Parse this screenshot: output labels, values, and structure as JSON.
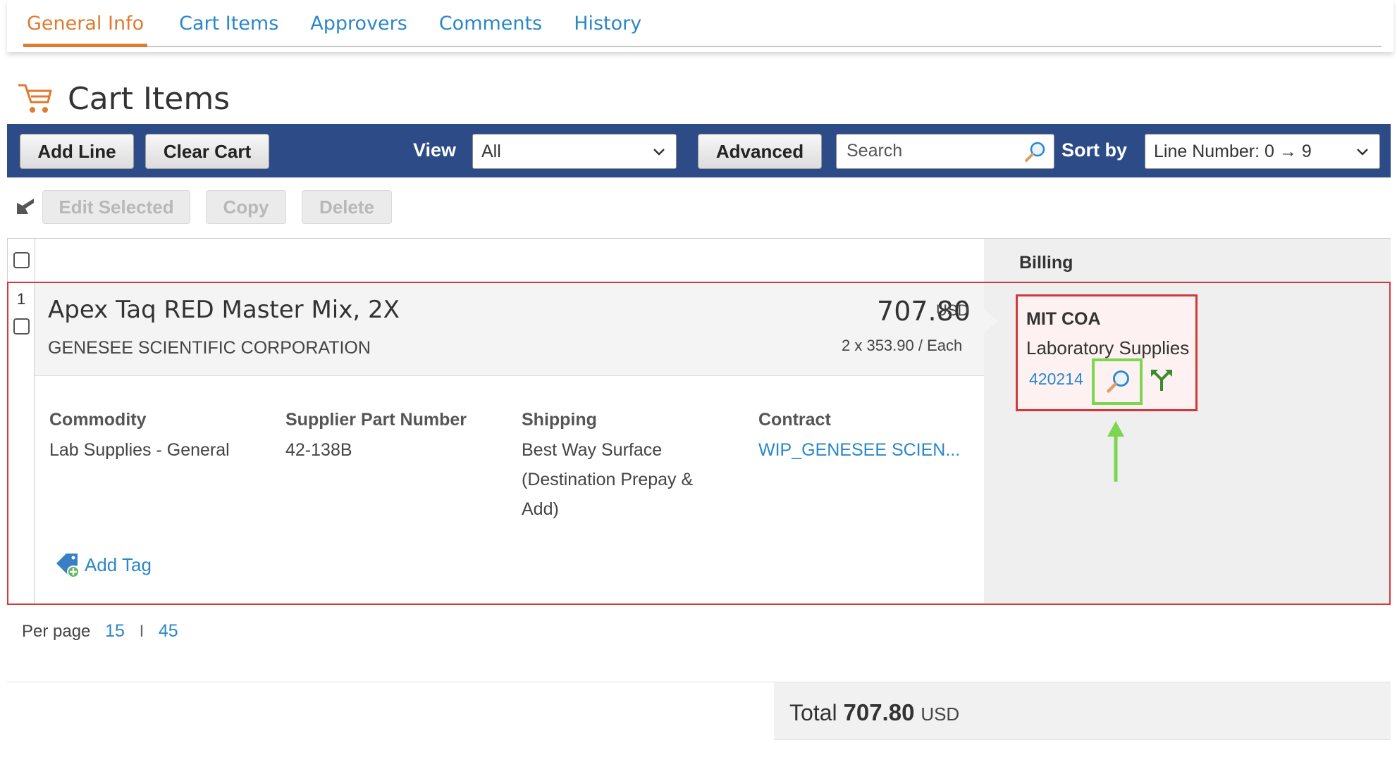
{
  "tabs": [
    {
      "label": "General Info",
      "active": true
    },
    {
      "label": "Cart Items"
    },
    {
      "label": "Approvers"
    },
    {
      "label": "Comments"
    },
    {
      "label": "History"
    }
  ],
  "section": {
    "title": "Cart Items"
  },
  "toolbar": {
    "add_line": "Add Line",
    "clear_cart": "Clear Cart",
    "view_label": "View",
    "view_value": "All",
    "advanced": "Advanced",
    "search_placeholder": "Search",
    "sort_label": "Sort by",
    "sort_value": "Line Number: 0 → 9"
  },
  "actions": {
    "edit_selected": "Edit Selected",
    "copy": "Copy",
    "delete": "Delete"
  },
  "table": {
    "billing_header": "Billing"
  },
  "item": {
    "line_number": "1",
    "title": "Apex Taq RED Master Mix, 2X",
    "supplier": "GENESEE SCIENTIFIC CORPORATION",
    "price": "707.80",
    "currency": "USD",
    "unit_price": "2 x 353.90 / Each",
    "commodity_label": "Commodity",
    "commodity_value": "Lab Supplies - General",
    "part_label": "Supplier Part Number",
    "part_value": "42-138B",
    "shipping_label": "Shipping",
    "shipping_line1": "Best Way Surface",
    "shipping_line2": "(Destination Prepay &",
    "shipping_line3": "Add)",
    "contract_label": "Contract",
    "contract_value": "WIP_GENESEE SCIEN...",
    "add_tag": "Add Tag"
  },
  "billing": {
    "title": "MIT COA",
    "subtitle": "Laboratory Supplies",
    "account": "420214"
  },
  "pagination": {
    "per_page_label": "Per page",
    "opt1": "15",
    "separator": "I",
    "opt2": "45"
  },
  "total": {
    "label": "Total",
    "amount": "707.80",
    "currency": "USD"
  },
  "colors": {
    "accent_orange": "#e07a2e",
    "link_blue": "#2a87c8",
    "toolbar_navy": "#2d4b87",
    "highlight_red": "#d23a3a",
    "annotation_green": "#7bd650"
  }
}
